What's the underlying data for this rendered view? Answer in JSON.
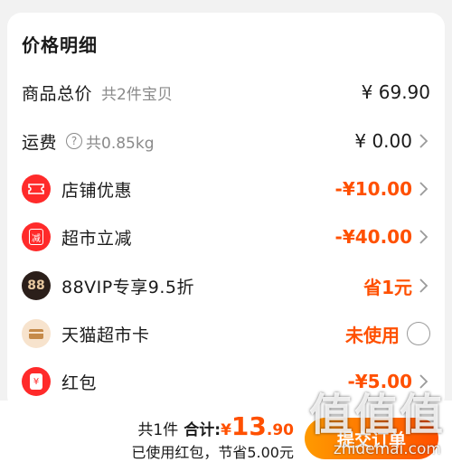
{
  "card": {
    "title": "价格明细"
  },
  "rows": {
    "goods": {
      "label": "商品总价",
      "sub": "共2件宝贝",
      "amount": "¥ 69.90"
    },
    "shipping": {
      "label": "运费",
      "help_glyph": "?",
      "sub": "共0.85kg",
      "amount": "¥ 0.00"
    },
    "shop_discount": {
      "label": "店铺优惠",
      "amount": "-¥10.00",
      "icon": "ticket-icon",
      "color": "#ff2a2a"
    },
    "market_cut": {
      "label": "超市立减",
      "badge": "减",
      "amount": "-¥40.00",
      "icon": "market-discount-icon",
      "color": "#ff2a2a"
    },
    "vip": {
      "label": "88VIP专享9.5折",
      "badge": "88",
      "amount": "省1元",
      "icon": "88vip-icon",
      "color": "#2b1f1a"
    },
    "tmall_card": {
      "label": "天猫超市卡",
      "amount": "未使用",
      "icon": "card-icon",
      "color": "#f3c79a"
    },
    "red_packet": {
      "label": "红包",
      "badge": "¥",
      "amount": "-¥5.00",
      "icon": "red-packet-icon",
      "color": "#ff2a2a"
    }
  },
  "bottom": {
    "count": "共1件",
    "total_label": "合计:",
    "currency": "¥",
    "price_int": "13",
    "price_dec": ".90",
    "saved": "已使用红包，节省5.00元",
    "submit": "提交订单"
  },
  "watermark": {
    "text": "值值值",
    "url": "zhidemai.com"
  },
  "colors": {
    "accent": "#ff5000",
    "background": "#f2f2f2"
  }
}
